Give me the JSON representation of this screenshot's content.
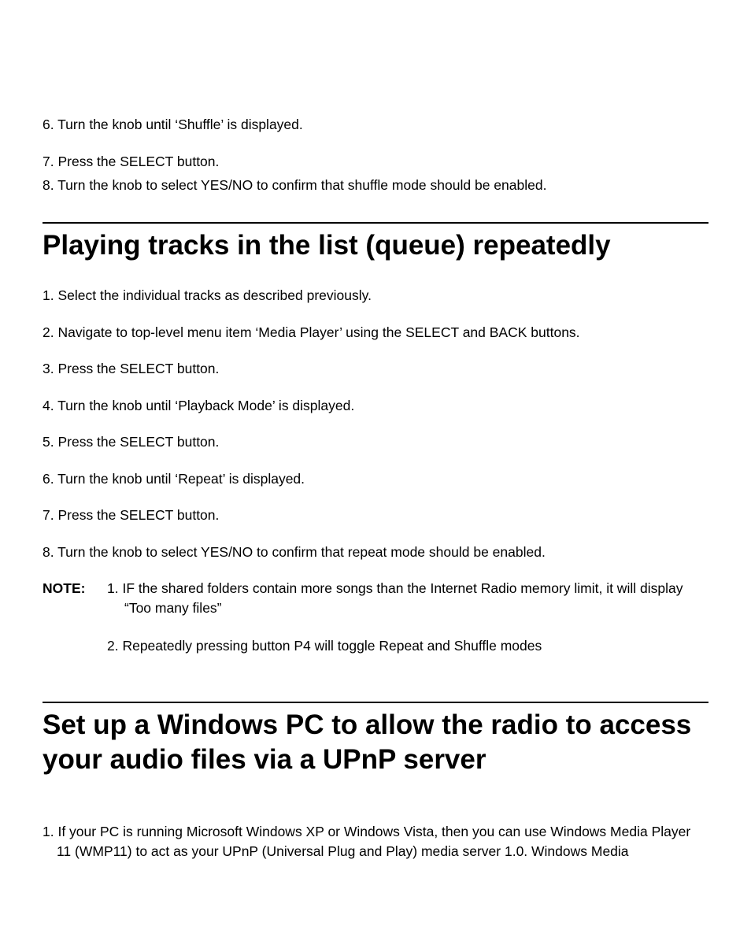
{
  "intro": {
    "step6": "6. Turn the knob until ‘Shuffle’ is displayed.",
    "step7": "7. Press the SELECT button.",
    "step8": "8. Turn the knob to select YES/NO to confirm that shuffle mode should be enabled."
  },
  "section1": {
    "heading": "Playing tracks in the list (queue) repeatedly",
    "step1": "1. Select the individual tracks as described previously.",
    "step2": "2. Navigate to top-level menu item ‘Media Player’ using the SELECT and BACK buttons.",
    "step3": "3. Press the SELECT button.",
    "step4": "4. Turn the knob until ‘Playback Mode’ is displayed.",
    "step5": "5. Press the SELECT button.",
    "step6": "6. Turn the knob until ‘Repeat’ is displayed.",
    "step7": "7. Press the SELECT button.",
    "step8": "8. Turn the knob to select YES/NO to confirm that repeat mode should be enabled.",
    "noteLabel": "NOTE:",
    "note1": "1. IF the shared folders contain more songs than the Internet Radio memory limit, it will display “Too many files”",
    "note2": "2. Repeatedly pressing button P4 will toggle Repeat and Shuffle modes"
  },
  "section2": {
    "heading": "Set up a Windows PC to allow the radio to access your audio files via a UPnP server",
    "step1": "1. If your PC is running Microsoft Windows XP or Windows Vista, then you can use Windows Media Player 11 (WMP11) to act as your UPnP (Universal Plug and Play) media server 1.0. Windows Media"
  }
}
